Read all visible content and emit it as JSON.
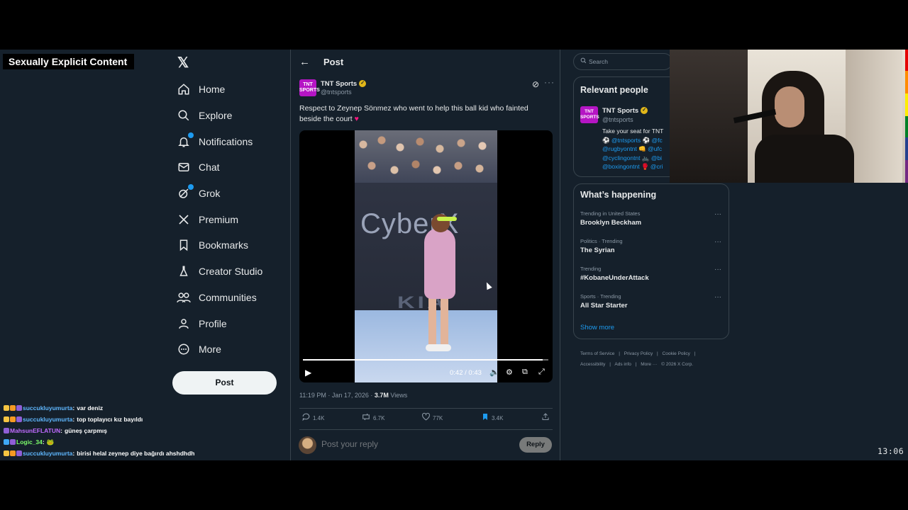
{
  "overlay": {
    "label": "Sexually Explicit Content"
  },
  "nav": {
    "logo": "𝕏",
    "items": [
      {
        "label": "Home",
        "icon": "home-icon"
      },
      {
        "label": "Explore",
        "icon": "search-icon"
      },
      {
        "label": "Notifications",
        "icon": "bell-icon"
      },
      {
        "label": "Chat",
        "icon": "mail-icon"
      },
      {
        "label": "Grok",
        "icon": "grok-icon"
      },
      {
        "label": "Premium",
        "icon": "x-icon"
      },
      {
        "label": "Bookmarks",
        "icon": "bookmark-icon"
      },
      {
        "label": "Creator Studio",
        "icon": "flask-icon"
      },
      {
        "label": "Communities",
        "icon": "people-icon"
      },
      {
        "label": "Profile",
        "icon": "person-icon"
      },
      {
        "label": "More",
        "icon": "more-circle-icon"
      }
    ],
    "post_button": "Post"
  },
  "header": {
    "title": "Post"
  },
  "post": {
    "avatar_text": "TNT SPORTS",
    "author_name": "TNT Sports",
    "author_handle": "@tntsports",
    "text": "Respect to Zeynep Sönmez who went to help this ball kid who fainted beside the court",
    "heart": "♥",
    "video": {
      "timecode": "0:42 / 0:43",
      "progress": 0.977,
      "sponsor_text": "CyberX",
      "brand_text": "KIA"
    },
    "meta_time": "11:19 PM · Jan 17, 2026 · ",
    "meta_views": "3.7M",
    "meta_views_label": " Views",
    "actions": {
      "replies": "1.4K",
      "reposts": "6.7K",
      "likes": "77K",
      "bookmarks": "3.4K"
    },
    "reply_placeholder": "Post your reply",
    "reply_button": "Reply"
  },
  "sidebar": {
    "search_placeholder": "Search",
    "relevant_title": "Relevant people",
    "relevant": {
      "name": "TNT Sports",
      "handle": "@tntsports",
      "bio_line1": "Take your seat for TNT",
      "bio_links": [
        "⚽ @tntsports ⚽ @fc",
        "@rugbyontnt 👊 @ufc",
        "@cyclingontnt 🚲 @bi",
        "@boxingontnt 🥊 @cri"
      ]
    },
    "happening_title": "What’s happening",
    "trends": [
      {
        "category": "Trending in United States",
        "name": "Brooklyn Beckham"
      },
      {
        "category": "Politics · Trending",
        "name": "The Syrian"
      },
      {
        "category": "Trending",
        "name": "#KobaneUnderAttack"
      },
      {
        "category": "Sports · Trending",
        "name": "All Star Starter"
      }
    ],
    "show_more": "Show more",
    "footer": [
      "Terms of Service",
      "|",
      "Privacy Policy",
      "|",
      "Cookie Policy",
      "|",
      "Accessibility",
      "|",
      "Ads info",
      "|",
      "More ···",
      "© 2026 X Corp."
    ]
  },
  "chat": [
    {
      "user": "succukluyumurta",
      "message": "var deniz",
      "color": "#5fb7ff"
    },
    {
      "user": "succukluyumurta",
      "message": "top toplayıcı kız bayıldı",
      "color": "#5fb7ff"
    },
    {
      "user": "MahsunEFLATUN",
      "message": "güneş çarpmış",
      "color": "#c06bff"
    },
    {
      "user": "Logic_34",
      "message": "🐸",
      "color": "#7dff6b"
    },
    {
      "user": "succukluyumurta",
      "message": "birisi helal zeynep diye bağırdı ahshdhdh",
      "color": "#5fb7ff"
    }
  ],
  "clock": "13:06",
  "colors": {
    "accent": "#1d9bf0",
    "background": "#15202b",
    "border": "#38444d",
    "like": "#f91880"
  }
}
